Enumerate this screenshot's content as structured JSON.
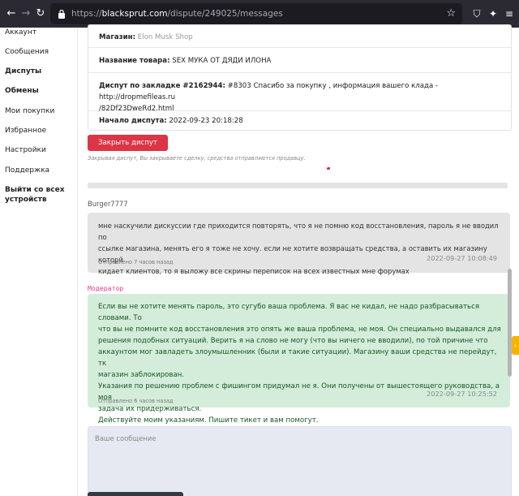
{
  "browser": {
    "url_prefix": "https://",
    "url_domain": "blacksprut.com",
    "url_path": "/dispute/249025/messages"
  },
  "sidebar": {
    "items": [
      {
        "label": "Аккаунт",
        "bold": false
      },
      {
        "label": "Сообщения",
        "bold": false
      },
      {
        "label": "Диспуты",
        "bold": true
      },
      {
        "label": "Обмены",
        "bold": true
      },
      {
        "label": "Мои покупки",
        "bold": false
      },
      {
        "label": "Избранное",
        "bold": false
      },
      {
        "label": "Настройки",
        "bold": false
      },
      {
        "label": "Поддержка",
        "bold": false
      }
    ],
    "logout_line1": "Выйти со всех",
    "logout_line2": "устройств"
  },
  "dispute": {
    "shop_label": "Магазин:",
    "shop_value": "Elon Musk Shop",
    "product_label": "Название товара:",
    "product_value": "SEX МУКА ОТ ДЯДИ ИЛОНА",
    "bookmark_label": "Диспут по закладке #2162944:",
    "bookmark_value_line1": "#8303 Спасибо за покупку , информация вашего клада - http://dropmefileas.ru",
    "bookmark_value_line2": "/82Df23DweRd2.html",
    "start_label": "Начало диспута:",
    "start_value": "2022-09-23 20:18:28",
    "close_button": "Закрыть диспут",
    "close_hint": "Закрывая диспут, Вы закрываете сделку, средства отправляются продавцу."
  },
  "messages": [
    {
      "author": "Burger7777",
      "lines": [
        "мне наскучили дискуссии где приходится повторять, что я не помню код восстановления, пароль я не вводил по",
        "ссылке магазина, менять его я тоже не хочу. если не хотите возвращать средства, а оставить их магазину которй",
        "кидает клиентов, то я выложу все скрины переписок на всех известных мне форумах"
      ],
      "sent": "Отправлено 7 часов назад",
      "timestamp": "2022-09-27 10:08:49"
    },
    {
      "author": "Модератор",
      "lines": [
        "Если вы не хотите менять пароль, это сугубо ваша проблема. Я вас не кидал, не надо разбрасываться словами. То",
        "что вы не помните код восстановления это опять же ваша проблема, не моя. Он специально выдавался для",
        "решения подобных ситуаций. Верить я на слово не могу (что вы ничего не вводили), по той причине что",
        "аккаунтом мог завладеть злоумышленник (были и такие ситуации). Магазину ваши средства не перейдут, тк",
        "магазин заблокирован.",
        "Указания по решению проблем с фишингом придумал не я. Они получены от вышестоящего руководства, а моя",
        "задача их придерживаться.",
        "Действуйте моим указаниям. Пишите тикет и вам помогут."
      ],
      "sent": "Отправлено 6 часов назад",
      "timestamp": "2022-09-27 10:25:52"
    }
  ],
  "compose": {
    "placeholder": "Ваше сообщение"
  },
  "colors": {
    "danger": "#dc3545",
    "moderator_bg": "#d4edda",
    "moderator_text": "#155724",
    "moderator_label": "#e83e8c",
    "user_bg": "#e4e4e4"
  },
  "icons": {
    "back": "arrow-left-icon",
    "forward": "arrow-right-icon",
    "reload": "reload-icon",
    "lock": "lock-icon",
    "bookmark": "star-icon",
    "pocket": "shield-icon",
    "extension": "extension-icon"
  }
}
